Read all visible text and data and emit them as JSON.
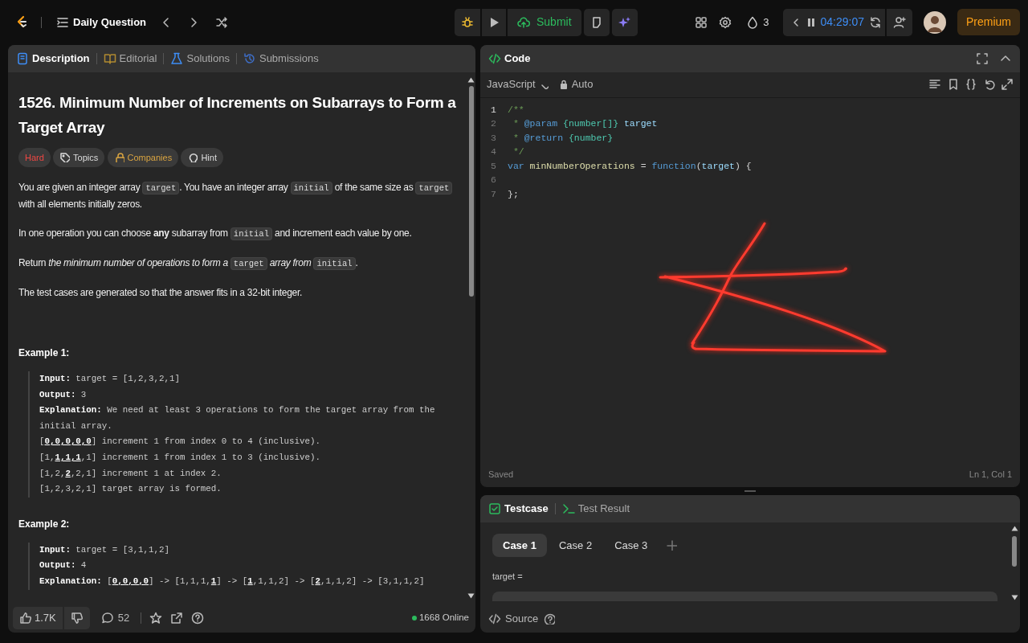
{
  "topbar": {
    "title": "Daily Question",
    "submit": "Submit",
    "streak": "3",
    "timer": "04:29:07",
    "premium": "Premium"
  },
  "description_panel": {
    "tabs": [
      {
        "label": "Description",
        "selected": true
      },
      {
        "label": "Editorial",
        "selected": false
      },
      {
        "label": "Solutions",
        "selected": false
      },
      {
        "label": "Submissions",
        "selected": false
      }
    ],
    "title": "1526. Minimum Number of Increments on Subarrays to Form a Target Array",
    "tags": [
      {
        "label": "Hard",
        "kind": "difficulty"
      },
      {
        "label": "Topics",
        "kind": "topics"
      },
      {
        "label": "Companies",
        "kind": "companies"
      },
      {
        "label": "Hint",
        "kind": "hint"
      }
    ],
    "paragraphs": [
      [
        {
          "kind": "text",
          "text": "You are given an integer array "
        },
        {
          "kind": "code",
          "text": "target"
        },
        {
          "kind": "text",
          "text": ". You have an integer array "
        },
        {
          "kind": "code",
          "text": "initial"
        },
        {
          "kind": "text",
          "text": " of the same size as "
        },
        {
          "kind": "code",
          "text": "target"
        },
        {
          "kind": "text",
          "text": " with all elements initially zeros."
        }
      ],
      [
        {
          "kind": "text",
          "text": "In one operation you can choose **any** subarray from "
        },
        {
          "kind": "code",
          "text": "initial"
        },
        {
          "kind": "text",
          "text": " and increment each value by one."
        }
      ],
      [
        {
          "kind": "text",
          "text": "Return *the minimum number of operations to form a* "
        },
        {
          "kind": "code",
          "text": "target"
        },
        {
          "kind": "text",
          "text": " *array from* "
        },
        {
          "kind": "code",
          "text": "initial"
        },
        {
          "kind": "text",
          "text": "."
        }
      ],
      [
        {
          "kind": "text",
          "text": "The test cases are generated so that the answer fits in a 32-bit integer."
        }
      ]
    ],
    "examples": [
      {
        "title": "Example 1:",
        "lines": [
          [
            {
              "kind": "label",
              "text": "Input:"
            },
            {
              "kind": "text",
              "text": " target = [1,2,3,2,1]"
            }
          ],
          [
            {
              "kind": "label",
              "text": "Output:"
            },
            {
              "kind": "text",
              "text": " 3"
            }
          ],
          [
            {
              "kind": "label",
              "text": "Explanation:"
            },
            {
              "kind": "text",
              "text": " We need at least 3 operations to form the target array from the initial array."
            }
          ],
          [
            {
              "kind": "text",
              "text": "["
            },
            {
              "kind": "strong",
              "text": "0,0,0,0,0"
            },
            {
              "kind": "text",
              "text": "] increment 1 from index 0 to 4 (inclusive)."
            }
          ],
          [
            {
              "kind": "text",
              "text": "[1,"
            },
            {
              "kind": "strong",
              "text": "1,1,1"
            },
            {
              "kind": "text",
              "text": ",1] increment 1 from index 1 to 3 (inclusive)."
            }
          ],
          [
            {
              "kind": "text",
              "text": "[1,2,"
            },
            {
              "kind": "strong",
              "text": "2"
            },
            {
              "kind": "text",
              "text": ",2,1] increment 1 at index 2."
            }
          ],
          [
            {
              "kind": "text",
              "text": "[1,2,3,2,1] target array is formed."
            }
          ]
        ]
      },
      {
        "title": "Example 2:",
        "lines": [
          [
            {
              "kind": "label",
              "text": "Input:"
            },
            {
              "kind": "text",
              "text": " target = [3,1,1,2]"
            }
          ],
          [
            {
              "kind": "label",
              "text": "Output:"
            },
            {
              "kind": "text",
              "text": " 4"
            }
          ],
          [
            {
              "kind": "label",
              "text": "Explanation:"
            },
            {
              "kind": "text",
              "text": " ["
            },
            {
              "kind": "strong",
              "text": "0,0,0,0"
            },
            {
              "kind": "text",
              "text": "] -> [1,1,1,"
            },
            {
              "kind": "strong",
              "text": "1"
            },
            {
              "kind": "text",
              "text": "] -> ["
            },
            {
              "kind": "strong",
              "text": "1"
            },
            {
              "kind": "text",
              "text": ",1,1,2] -> ["
            },
            {
              "kind": "strong",
              "text": "2"
            },
            {
              "kind": "text",
              "text": ",1,1,2] -> [3,1,1,2]"
            }
          ]
        ]
      }
    ],
    "likes": "1.7K",
    "comments": "52",
    "online": "1668 Online"
  },
  "code_panel": {
    "title": "Code",
    "language": "JavaScript",
    "mode": "Auto",
    "lines": [
      {
        "number": "1",
        "tokens": [
          {
            "kind": "comment",
            "text": "/**"
          }
        ]
      },
      {
        "number": "2",
        "tokens": [
          {
            "kind": "comment",
            "text": " * "
          },
          {
            "kind": "tag",
            "text": "@param"
          },
          {
            "kind": "type",
            "text": " {number[]}"
          },
          {
            "kind": "ident",
            "text": " target"
          }
        ]
      },
      {
        "number": "3",
        "tokens": [
          {
            "kind": "comment",
            "text": " * "
          },
          {
            "kind": "tag",
            "text": "@return"
          },
          {
            "kind": "type",
            "text": " {number}"
          }
        ]
      },
      {
        "number": "4",
        "tokens": [
          {
            "kind": "comment",
            "text": " */"
          }
        ]
      },
      {
        "number": "5",
        "tokens": [
          {
            "kind": "keyword",
            "text": "var "
          },
          {
            "kind": "func",
            "text": "minNumberOperations"
          },
          {
            "kind": "punct",
            "text": " = "
          },
          {
            "kind": "keyword",
            "text": "function"
          },
          {
            "kind": "punct",
            "text": "("
          },
          {
            "kind": "ident",
            "text": "target"
          },
          {
            "kind": "punct",
            "text": ") {"
          }
        ]
      },
      {
        "number": "6"
      },
      {
        "number": "7",
        "tokens": [
          {
            "kind": "punct",
            "text": "};"
          }
        ]
      }
    ],
    "status": "Saved",
    "cursor": "Ln 1, Col 1"
  },
  "testcase_panel": {
    "tabs": [
      {
        "label": "Testcase",
        "selected": true
      },
      {
        "label": "Test Result",
        "selected": false
      }
    ],
    "cases": [
      {
        "label": "Case 1",
        "selected": true
      },
      {
        "label": "Case 2",
        "selected": false
      },
      {
        "label": "Case 3",
        "selected": false
      }
    ],
    "param_label": "target =",
    "source": "Source"
  }
}
